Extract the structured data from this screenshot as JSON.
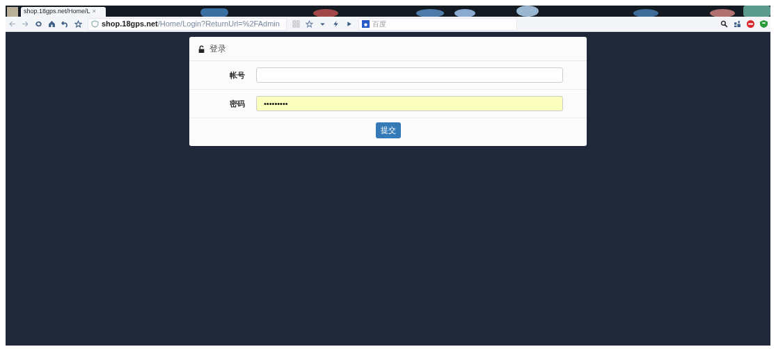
{
  "browser": {
    "tab": {
      "title": "shop.18gps.net/Home/L",
      "close": "×",
      "selected": true
    },
    "address": {
      "host": "shop.18gps.net",
      "path": "/Home/Login?ReturnUrl=%2FAdmin"
    },
    "search": {
      "engine": "百度"
    }
  },
  "login": {
    "title": "登录",
    "fields": [
      {
        "label": "帐号",
        "autofilled": false
      },
      {
        "label": "密码",
        "value": "•••••••••",
        "autofilled": true
      }
    ],
    "submit": "提交"
  }
}
